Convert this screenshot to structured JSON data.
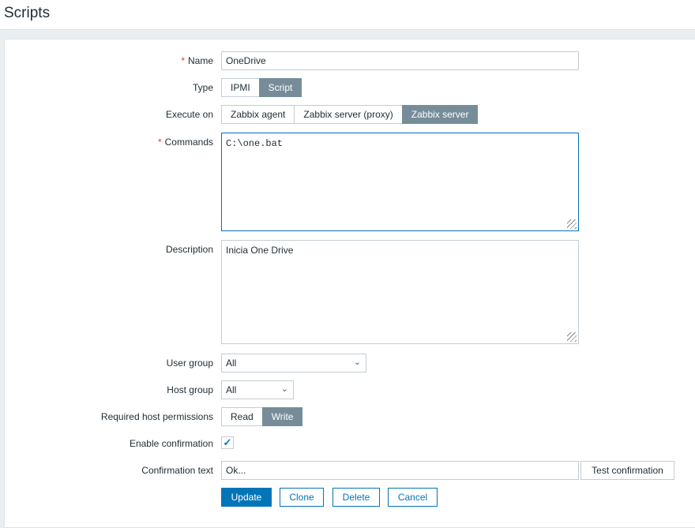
{
  "page": {
    "title": "Scripts"
  },
  "form": {
    "name": {
      "label": "Name",
      "value": "OneDrive"
    },
    "type": {
      "label": "Type",
      "options": [
        "IPMI",
        "Script"
      ],
      "selected": "Script"
    },
    "execute_on": {
      "label": "Execute on",
      "options": [
        "Zabbix agent",
        "Zabbix server (proxy)",
        "Zabbix server"
      ],
      "selected": "Zabbix server"
    },
    "commands": {
      "label": "Commands",
      "value": "C:\\one.bat"
    },
    "description": {
      "label": "Description",
      "value": "Inicia One Drive"
    },
    "user_group": {
      "label": "User group",
      "value": "All"
    },
    "host_group": {
      "label": "Host group",
      "value": "All"
    },
    "permissions": {
      "label": "Required host permissions",
      "options": [
        "Read",
        "Write"
      ],
      "selected": "Write"
    },
    "enable_confirmation": {
      "label": "Enable confirmation",
      "checked": true
    },
    "confirmation_text": {
      "label": "Confirmation text",
      "value": "Ok...",
      "test_label": "Test confirmation"
    }
  },
  "actions": {
    "update": "Update",
    "clone": "Clone",
    "delete": "Delete",
    "cancel": "Cancel"
  },
  "required_mark": "*"
}
